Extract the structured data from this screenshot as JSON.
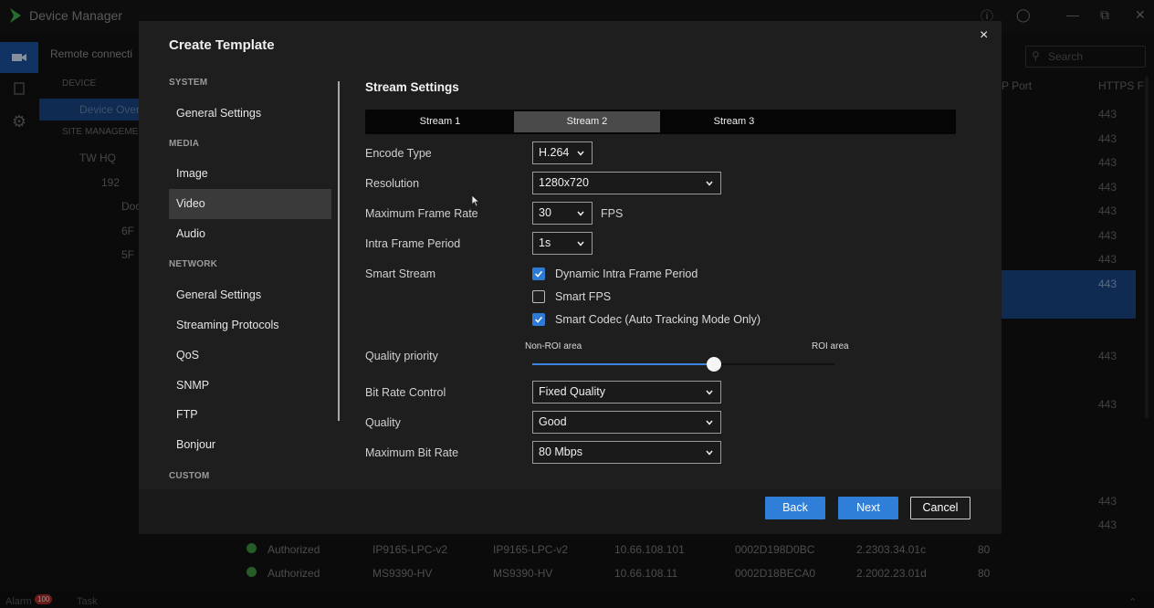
{
  "app": {
    "title": "Device Manager",
    "tree_tab": "Remote connecti",
    "tree_header_device": "DEVICE",
    "tree_header_site": "SITE MANAGEME",
    "tree_items": [
      "Device Over",
      "TW HQ",
      "192",
      "Doc",
      "6F",
      "5F"
    ],
    "search_placeholder": "Search",
    "col_port": "P Port",
    "col_https": "HTTPS F",
    "ports": [
      "443",
      "443",
      "443",
      "443",
      "443",
      "443",
      "443",
      "443",
      "443",
      "443",
      "443",
      "443"
    ],
    "rows": [
      {
        "status": "Authorized",
        "model": "IP9165-LPC-v2",
        "model2": "IP9165-LPC-v2",
        "ip": "10.66.108.101",
        "mac": "0002D198D0BC",
        "fw": "2.2303.34.01c",
        "port": "80"
      },
      {
        "status": "Authorized",
        "model": "MS9390-HV",
        "model2": "MS9390-HV",
        "ip": "10.66.108.11",
        "mac": "0002D18BECA0",
        "fw": "2.2002.23.01d",
        "port": "80"
      }
    ],
    "status_alarm": "Alarm",
    "alarm_count": "100",
    "status_task": "Task"
  },
  "modal": {
    "title": "Create Template",
    "close": "×",
    "nav": {
      "system_header": "SYSTEM",
      "media_header": "MEDIA",
      "network_header": "NETWORK",
      "custom_header": "CUSTOM",
      "items": {
        "sys_general": "General Settings",
        "image": "Image",
        "video": "Video",
        "audio": "Audio",
        "net_general": "General Settings",
        "streaming": "Streaming Protocols",
        "qos": "QoS",
        "snmp": "SNMP",
        "ftp": "FTP",
        "bonjour": "Bonjour"
      }
    },
    "section_title": "Stream Settings",
    "tabs": [
      "Stream 1",
      "Stream 2",
      "Stream 3"
    ],
    "active_tab": "Stream 2",
    "fields": {
      "encode_type_label": "Encode Type",
      "encode_type": "H.264",
      "resolution_label": "Resolution",
      "resolution": "1280x720",
      "max_frame_rate_label": "Maximum Frame Rate",
      "max_frame_rate": "30",
      "fps_unit": "FPS",
      "intra_frame_label": "Intra Frame Period",
      "intra_frame": "1s",
      "smart_stream_label": "Smart Stream",
      "smart_stream_options": [
        {
          "label": "Dynamic Intra Frame Period",
          "checked": true
        },
        {
          "label": "Smart FPS",
          "checked": false
        },
        {
          "label": "Smart Codec (Auto Tracking Mode Only)",
          "checked": true
        }
      ],
      "quality_priority_label": "Quality priority",
      "slider_left": "Non-ROI area",
      "slider_right": "ROI area",
      "slider_value": 0.6,
      "bit_rate_control_label": "Bit Rate Control",
      "bit_rate_control": "Fixed Quality",
      "quality_label": "Quality",
      "quality": "Good",
      "max_bit_rate_label": "Maximum Bit Rate",
      "max_bit_rate": "80 Mbps"
    },
    "buttons": {
      "back": "Back",
      "next": "Next",
      "cancel": "Cancel"
    },
    "colors": {
      "accent": "#2f7fd8",
      "selection": "#17427f",
      "check": "#2e7bd6"
    }
  }
}
